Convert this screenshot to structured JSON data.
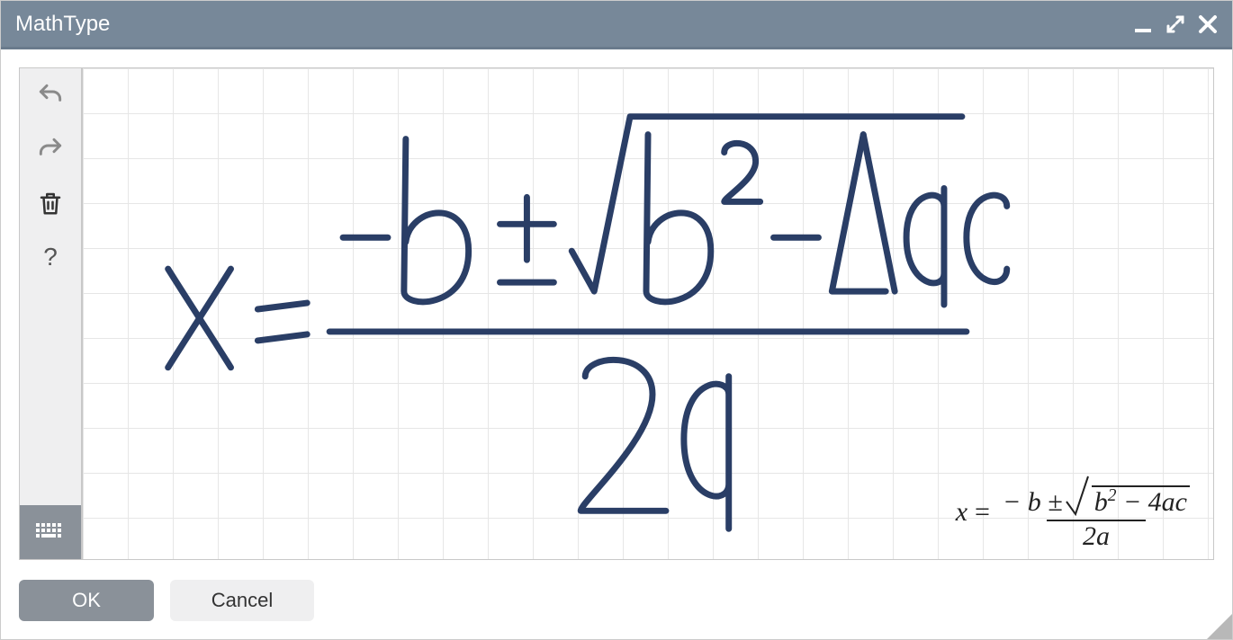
{
  "window": {
    "title": "MathType"
  },
  "toolbar": {
    "undo": "undo",
    "redo": "redo",
    "delete": "delete",
    "help": "?",
    "keyboard": "keyboard"
  },
  "handwriting": {
    "expression_latex": "x = \\frac{-b \\pm \\sqrt{b^2 - 4ac}}{2a}",
    "ink_color": "#2a3e66"
  },
  "rendered_preview": {
    "lhs": "x",
    "eq": "=",
    "numerator_prefix": "− b ±",
    "radicand": "b",
    "radicand_exp": "2",
    "radicand_tail": " − 4ac",
    "denominator": "2a"
  },
  "footer": {
    "ok_label": "OK",
    "cancel_label": "Cancel"
  },
  "colors": {
    "titlebar": "#778899",
    "ink": "#2a3e66",
    "toolbar_bg": "#efeff0",
    "keyboard_btn": "#8a9199"
  }
}
